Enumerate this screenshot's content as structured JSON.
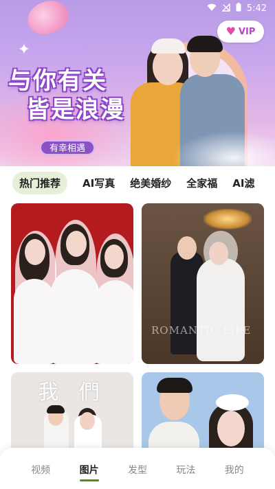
{
  "status_bar": {
    "time": "5:42",
    "icons": [
      "wifi-icon",
      "signal-off-icon",
      "battery-icon"
    ]
  },
  "banner": {
    "title_line_1": "与你有关",
    "title_line_2": "皆是浪漫",
    "tag": "有幸相遇"
  },
  "vip_button": {
    "label": "VIP",
    "icon": "heart-v-icon",
    "accent": "#e24ea5"
  },
  "categories": {
    "items": [
      {
        "label": "热门推荐",
        "active": true
      },
      {
        "label": "AI写真",
        "active": false
      },
      {
        "label": "绝美婚纱",
        "active": false
      },
      {
        "label": "全家福",
        "active": false
      },
      {
        "label": "AI滤",
        "active": false
      }
    ]
  },
  "grid": {
    "cards": [
      {
        "name": "photo-card-1"
      },
      {
        "name": "photo-card-2",
        "watermark": "ROMANTIC LIFE"
      },
      {
        "name": "photo-card-3",
        "title": "我 們"
      },
      {
        "name": "photo-card-4"
      }
    ]
  },
  "bottom_nav": {
    "items": [
      {
        "label": "视频",
        "active": false
      },
      {
        "label": "图片",
        "active": true
      },
      {
        "label": "发型",
        "active": false
      },
      {
        "label": "玩法",
        "active": false
      },
      {
        "label": "我的",
        "active": false
      }
    ],
    "accent": "#5f7f3d"
  }
}
